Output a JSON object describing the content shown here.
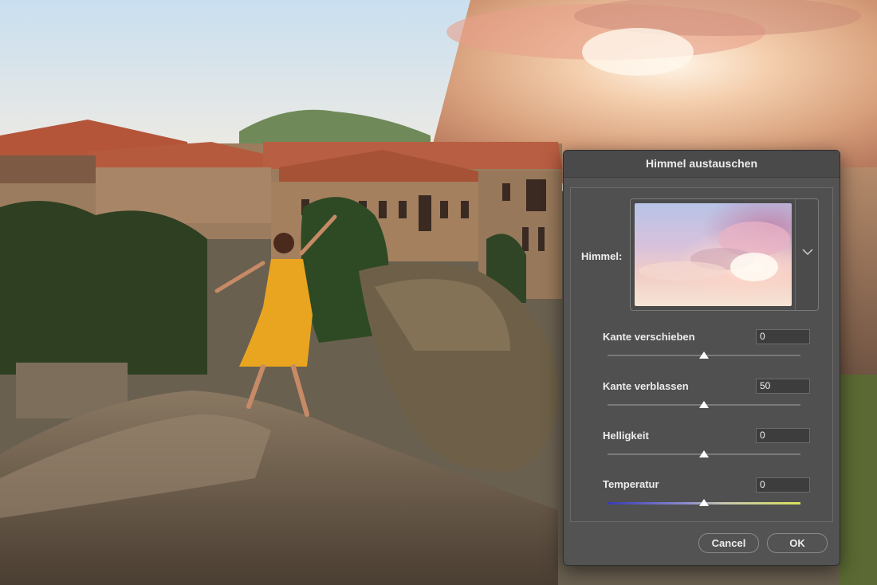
{
  "dialog": {
    "title": "Himmel austauschen",
    "sky_label": "Himmel:",
    "sky_preset": "sky-preset-thumbnail",
    "controls": [
      {
        "label": "Kante verschieben",
        "value": "0",
        "slider_fraction": 0.5
      },
      {
        "label": "Kante verblassen",
        "value": "50",
        "slider_fraction": 0.5
      },
      {
        "label": "Helligkeit",
        "value": "0",
        "slider_fraction": 0.5
      },
      {
        "label": "Temperatur",
        "value": "0",
        "slider_fraction": 0.5
      }
    ],
    "cancel_label": "Cancel",
    "ok_label": "OK"
  },
  "icons": {
    "dropdown": "chevron-down-icon"
  },
  "colors": {
    "dialog_bg": "#535353",
    "field_bg": "#3d3d3d",
    "temperature_cold": "#3a3ab5",
    "temperature_warm": "#d9e05a"
  }
}
